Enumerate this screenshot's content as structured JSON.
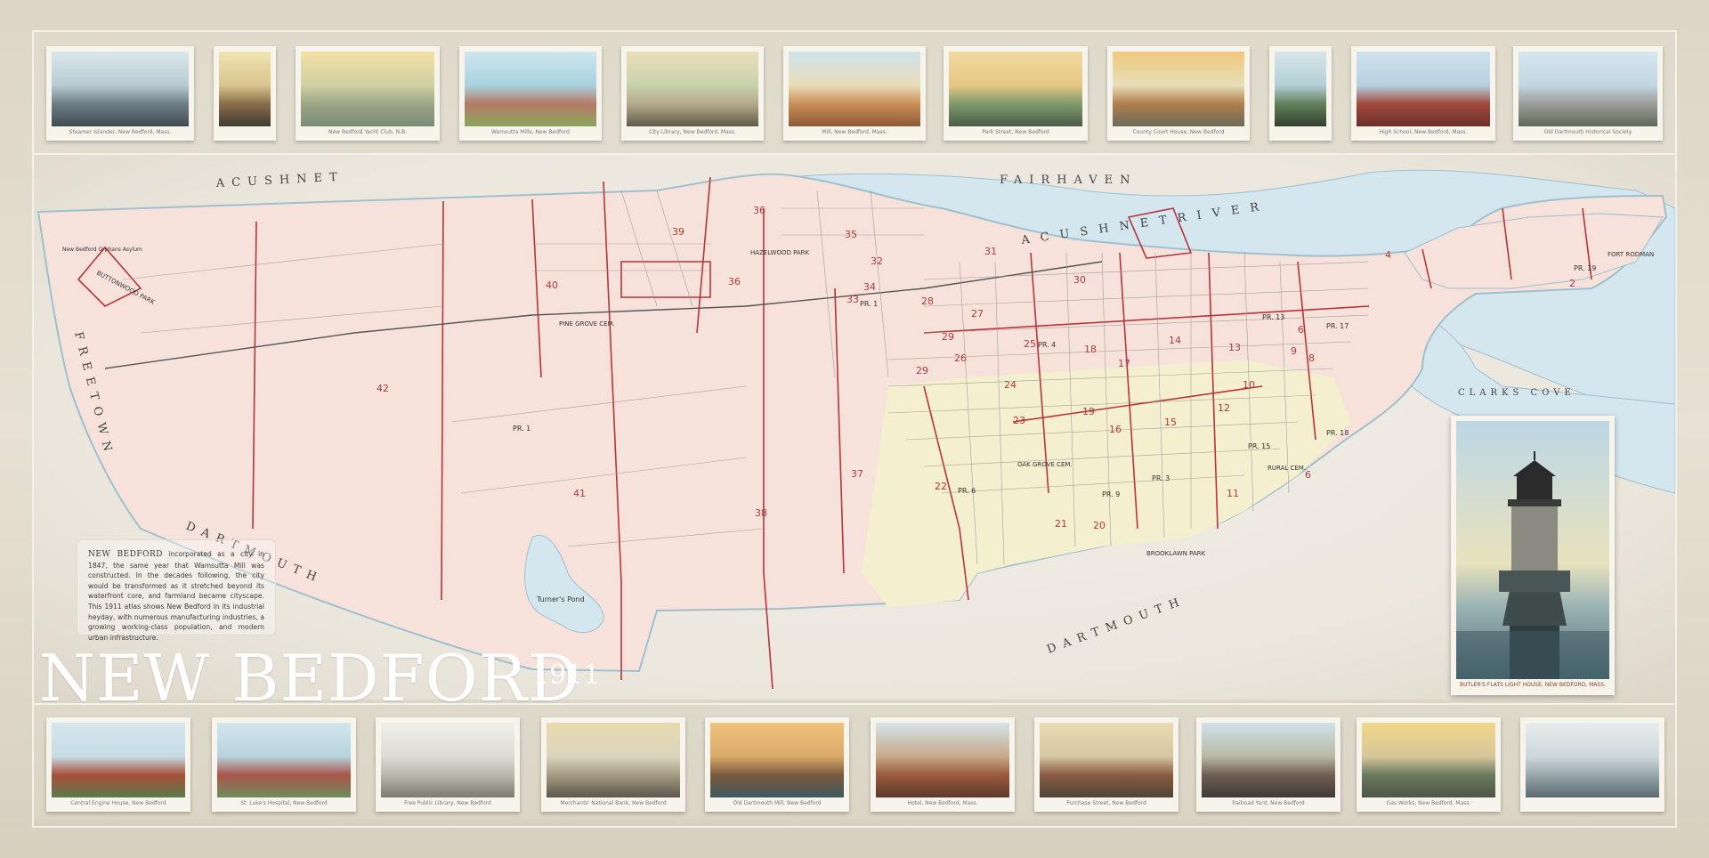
{
  "map": {
    "title": "NEW BEDFORD",
    "year": "1911",
    "towns": {
      "acushnet": "ACUSHNET",
      "fairhaven": "FAIRHAVEN",
      "freetown": "FREETOWN",
      "dartmouth_west": "DARTMOUTH",
      "dartmouth_east": "DARTMOUTH"
    },
    "water": {
      "acushnet_river": "A C U S H N E T   R I V E R",
      "clarks_cove": "CLARKS COVE",
      "turners_pond": "Turner's Pond"
    },
    "places": {
      "buttonwood_park": "BUTTONWOOD PARK",
      "hazelwood_park": "HAZELWOOD PARK",
      "fort_rodman": "FORT RODMAN",
      "oak_grove_cem": "OAK GROVE CEM.",
      "rural_cem": "RURAL CEM.",
      "pine_grove_cem": "PINE GROVE CEM.",
      "brooklawn_park": "BROOKLAWN PARK",
      "new_bedford_orphans_asylum": "New Bedford Orphans Asylum"
    },
    "wards": [
      "2",
      "4",
      "6",
      "6",
      "8",
      "9",
      "10",
      "11",
      "12",
      "13",
      "14",
      "15",
      "16",
      "17",
      "18",
      "19",
      "20",
      "21",
      "22",
      "23",
      "24",
      "25",
      "26",
      "27",
      "28",
      "29",
      "29",
      "30",
      "31",
      "32",
      "33",
      "34",
      "35",
      "36",
      "36",
      "37",
      "38",
      "39",
      "40",
      "41",
      "42"
    ],
    "precincts": [
      "PR. 1",
      "PR. 1",
      "PR. 6",
      "PR. 13",
      "PR. 17",
      "PR. 18",
      "PR. 19",
      "PR. 15",
      "PR. 9",
      "PR. 3",
      "PR. 4"
    ],
    "intro": {
      "lead": "NEW BEDFORD",
      "text": " incorporated as a city in 1847, the same year that Wamsutta Mill was constructed. In the decades following, the city would be transformed as it stretched beyond its waterfront core, and farmland became cityscape. This 1911 atlas shows New Bedford in its industrial heyday, with numerous manufacturing industries, a growing working-class population, and modern urban infrastructure."
    }
  },
  "postcards_top": [
    {
      "caption": "Steamer Islander, New Bedford, Mass.",
      "colors": [
        "#dbe8ee",
        "#b7cad2",
        "#6f7e86",
        "#3f4b52"
      ]
    },
    {
      "caption": "",
      "colors": [
        "#f0e4b2",
        "#d8c48c",
        "#8a6e4a",
        "#3f3b34"
      ]
    },
    {
      "caption": "New Bedford Yacht Club, N.B.",
      "colors": [
        "#f3e1a6",
        "#cfd0a4",
        "#9da685",
        "#7b8a78"
      ]
    },
    {
      "caption": "Wamsutta Mills, New Bedford",
      "colors": [
        "#cfe6ee",
        "#a8d2df",
        "#b67a64",
        "#8aa65e"
      ]
    },
    {
      "caption": "City Library, New Bedford, Mass.",
      "colors": [
        "#eadfb8",
        "#c7d2ad",
        "#b6a98a",
        "#5f5a4a"
      ]
    },
    {
      "caption": "Mill, New Bedford, Mass.",
      "colors": [
        "#cfe3ec",
        "#eadcb8",
        "#c98e58",
        "#8c5a35"
      ]
    },
    {
      "caption": "Park Street, New Bedford",
      "colors": [
        "#f1d9a0",
        "#e6c684",
        "#7f9a6e",
        "#4b5b45"
      ]
    },
    {
      "caption": "County Court House, New Bedford",
      "colors": [
        "#f0c87c",
        "#e7dfb9",
        "#b07e4c",
        "#6c6a5a"
      ]
    },
    {
      "caption": "",
      "colors": [
        "#d7e5e8",
        "#b3cfd7",
        "#62805a",
        "#33402e"
      ]
    },
    {
      "caption": "High School, New Bedford, Mass.",
      "colors": [
        "#cfe2ee",
        "#b7d0e0",
        "#a24a3e",
        "#6b2f28"
      ]
    },
    {
      "caption": "Old Dartmouth Historical Society",
      "colors": [
        "#d7e7ef",
        "#c2d6df",
        "#9c9c98",
        "#5e6a5a"
      ]
    }
  ],
  "postcards_bottom": [
    {
      "caption": "Central Engine House, New Bedford",
      "colors": [
        "#d5e6ec",
        "#c7dce4",
        "#a8503c",
        "#5a7a4a"
      ]
    },
    {
      "caption": "St. Luke's Hospital, New Bedford",
      "colors": [
        "#d3e5ec",
        "#b6d3de",
        "#a9564a",
        "#6d8d5a"
      ]
    },
    {
      "caption": "Free Public Library, New Bedford",
      "colors": [
        "#eef0ea",
        "#dcdcd2",
        "#b9b8ae",
        "#7d7a6e"
      ]
    },
    {
      "caption": "Merchants' National Bank, New Bedford",
      "colors": [
        "#e8d9b0",
        "#dcd4bd",
        "#a69b82",
        "#5c574c"
      ]
    },
    {
      "caption": "Old Dartmouth Mill, New Bedford",
      "colors": [
        "#f0c27a",
        "#d9a96a",
        "#7a5a3e",
        "#3f5960"
      ]
    },
    {
      "caption": "Hotel, New Bedford, Mass.",
      "colors": [
        "#d5e4ea",
        "#c7a98a",
        "#9a5a3e",
        "#5e3a2c"
      ]
    },
    {
      "caption": "Purchase Street, New Bedford",
      "colors": [
        "#e9dcb2",
        "#d4c7a2",
        "#8a5a42",
        "#4f4438"
      ]
    },
    {
      "caption": "Railroad Yard, New Bedford",
      "colors": [
        "#cfe2ea",
        "#b9b9a5",
        "#6e5e52",
        "#3e3a36"
      ]
    },
    {
      "caption": "Gas Works, New Bedford, Mass.",
      "colors": [
        "#f0d78a",
        "#d7c79a",
        "#6a7a5e",
        "#4c5646"
      ]
    },
    {
      "caption": "",
      "colors": [
        "#e9ecec",
        "#cdd8dc",
        "#9aa7ab",
        "#5a6a70"
      ]
    }
  ],
  "lighthouse": {
    "caption": "BUTLER'S FLATS LIGHT HOUSE, NEW BEDFORD, MASS."
  },
  "colors": {
    "land": "#f6e2da",
    "land_east": "#f3efcf",
    "water": "#d4e6ee",
    "ward_line": "#b9343a",
    "title": "#ffffff"
  }
}
